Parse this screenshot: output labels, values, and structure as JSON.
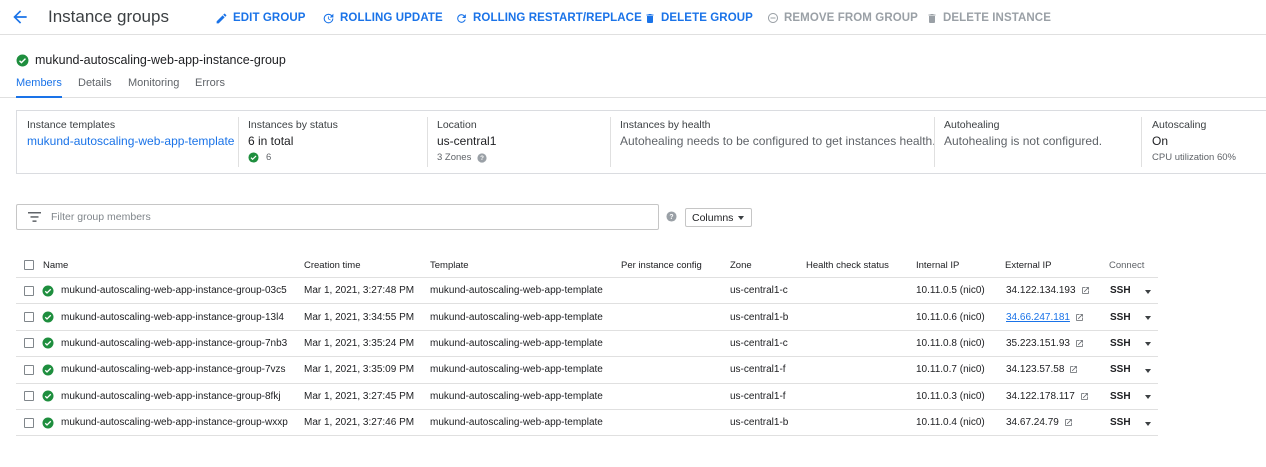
{
  "header": {
    "title": "Instance groups",
    "actions": {
      "edit": "EDIT GROUP",
      "rolling_update": "ROLLING UPDATE",
      "rolling_restart": "ROLLING RESTART/REPLACE",
      "delete_group": "DELETE GROUP",
      "remove_from_group": "REMOVE FROM GROUP",
      "delete_instance": "DELETE INSTANCE"
    }
  },
  "group": {
    "name": "mukund-autoscaling-web-app-instance-group"
  },
  "tabs": [
    "Members",
    "Details",
    "Monitoring",
    "Errors"
  ],
  "summary": {
    "templates": {
      "label": "Instance templates",
      "value": "mukund-autoscaling-web-app-template"
    },
    "status": {
      "label": "Instances by status",
      "value": "6 in total",
      "count": "6"
    },
    "location": {
      "label": "Location",
      "value": "us-central1",
      "zones": "3 Zones"
    },
    "health": {
      "label": "Instances by health",
      "value": "Autohealing needs to be configured to get instances health."
    },
    "autohealing": {
      "label": "Autohealing",
      "value": "Autohealing is not configured."
    },
    "autoscaling": {
      "label": "Autoscaling",
      "value": "On",
      "sub": "CPU utilization 60%"
    }
  },
  "filter": {
    "placeholder": "Filter group members",
    "columns_label": "Columns"
  },
  "table": {
    "columns": [
      "Name",
      "Creation time",
      "Template",
      "Per instance config",
      "Zone",
      "Health check status",
      "Internal IP",
      "External IP",
      "Connect"
    ],
    "rows": [
      {
        "name": "mukund-autoscaling-web-app-instance-group-03c5",
        "created": "Mar 1, 2021, 3:27:48 PM",
        "template": "mukund-autoscaling-web-app-template",
        "zone": "us-central1-c",
        "internal_ip": "10.11.0.5 (nic0)",
        "external_ip": "34.122.134.193",
        "connect": "SSH"
      },
      {
        "name": "mukund-autoscaling-web-app-instance-group-13l4",
        "created": "Mar 1, 2021, 3:34:55 PM",
        "template": "mukund-autoscaling-web-app-template",
        "zone": "us-central1-b",
        "internal_ip": "10.11.0.6 (nic0)",
        "external_ip": "34.66.247.181",
        "connect": "SSH"
      },
      {
        "name": "mukund-autoscaling-web-app-instance-group-7nb3",
        "created": "Mar 1, 2021, 3:35:24 PM",
        "template": "mukund-autoscaling-web-app-template",
        "zone": "us-central1-c",
        "internal_ip": "10.11.0.8 (nic0)",
        "external_ip": "35.223.151.93",
        "connect": "SSH"
      },
      {
        "name": "mukund-autoscaling-web-app-instance-group-7vzs",
        "created": "Mar 1, 2021, 3:35:09 PM",
        "template": "mukund-autoscaling-web-app-template",
        "zone": "us-central1-f",
        "internal_ip": "10.11.0.7 (nic0)",
        "external_ip": "34.123.57.58",
        "connect": "SSH"
      },
      {
        "name": "mukund-autoscaling-web-app-instance-group-8fkj",
        "created": "Mar 1, 2021, 3:27:45 PM",
        "template": "mukund-autoscaling-web-app-template",
        "zone": "us-central1-f",
        "internal_ip": "10.11.0.3 (nic0)",
        "external_ip": "34.122.178.117",
        "connect": "SSH"
      },
      {
        "name": "mukund-autoscaling-web-app-instance-group-wxxp",
        "created": "Mar 1, 2021, 3:27:46 PM",
        "template": "mukund-autoscaling-web-app-template",
        "zone": "us-central1-b",
        "internal_ip": "10.11.0.4 (nic0)",
        "external_ip": "34.67.24.79",
        "connect": "SSH"
      }
    ]
  },
  "colors": {
    "accent": "#1a73e8",
    "healthy": "#1e8e3e",
    "disabled": "#9aa0a6"
  }
}
